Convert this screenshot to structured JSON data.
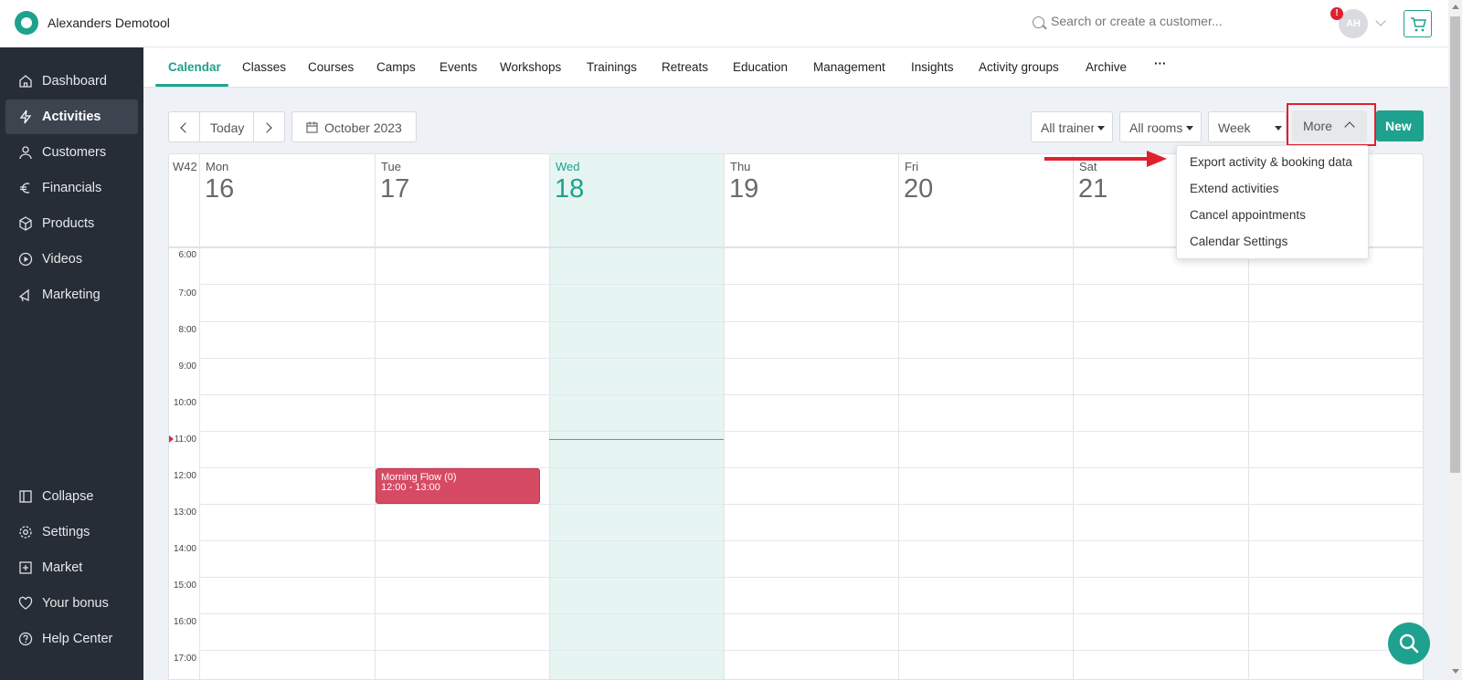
{
  "app": {
    "title": "Alexanders Demotool"
  },
  "search": {
    "placeholder": "Search or create a customer..."
  },
  "user": {
    "initials": "AH",
    "alert_badge": "!"
  },
  "colors": {
    "accent": "#1ea18e",
    "sidebar": "#262d36",
    "event": "#d64a64",
    "highlight": "#e0202e"
  },
  "sidebar": {
    "items": [
      {
        "label": "Dashboard",
        "icon": "home-icon"
      },
      {
        "label": "Activities",
        "icon": "lightning-icon",
        "active": true
      },
      {
        "label": "Customers",
        "icon": "person-icon"
      },
      {
        "label": "Financials",
        "icon": "euro-icon"
      },
      {
        "label": "Products",
        "icon": "box-icon"
      },
      {
        "label": "Videos",
        "icon": "play-icon"
      },
      {
        "label": "Marketing",
        "icon": "megaphone-icon"
      }
    ],
    "bottom": [
      {
        "label": "Collapse",
        "icon": "collapse-icon"
      },
      {
        "label": "Settings",
        "icon": "gear-icon"
      },
      {
        "label": "Market",
        "icon": "plus-box-icon"
      },
      {
        "label": "Your bonus",
        "icon": "heart-icon"
      },
      {
        "label": "Help Center",
        "icon": "question-icon"
      }
    ]
  },
  "tabs": [
    "Calendar",
    "Classes",
    "Courses",
    "Camps",
    "Events",
    "Workshops",
    "Trainings",
    "Retreats",
    "Education",
    "Management",
    "Insights",
    "Activity groups",
    "Archive",
    "···"
  ],
  "toolbar": {
    "today": "Today",
    "date_range": "October 2023",
    "trainer_filter": "All trainers",
    "room_filter": "All rooms",
    "view": "Week",
    "more": "More",
    "new": "New"
  },
  "more_menu": [
    "Export activity & booking data",
    "Extend activities",
    "Cancel appointments",
    "Calendar Settings"
  ],
  "calendar": {
    "week_label": "W42",
    "days": [
      {
        "name": "Mon",
        "num": "16"
      },
      {
        "name": "Tue",
        "num": "17"
      },
      {
        "name": "Wed",
        "num": "18",
        "today": true
      },
      {
        "name": "Thu",
        "num": "19"
      },
      {
        "name": "Fri",
        "num": "20"
      },
      {
        "name": "Sat",
        "num": "21"
      }
    ],
    "hours": [
      "6:00",
      "7:00",
      "8:00",
      "9:00",
      "10:00",
      "11:00",
      "12:00",
      "13:00",
      "14:00",
      "15:00",
      "16:00",
      "17:00"
    ],
    "events": [
      {
        "title": "Morning Flow (0)",
        "time": "12:00 - 13:00",
        "day": "Tue"
      }
    ]
  }
}
